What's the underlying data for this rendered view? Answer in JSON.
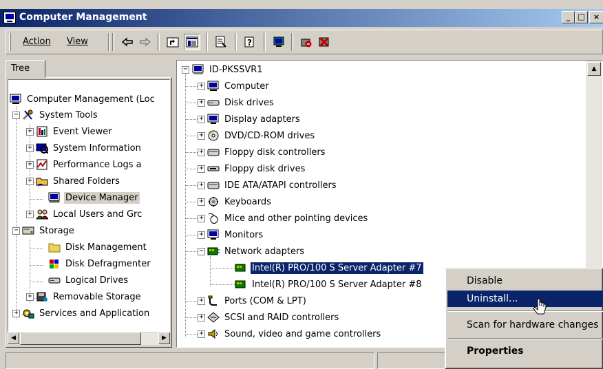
{
  "window": {
    "title": "Computer Management"
  },
  "menu": {
    "action": "Action",
    "action_key": "A",
    "view": "View",
    "view_key": "V"
  },
  "tree_tab": "Tree",
  "left_tree": [
    {
      "label": "Computer Management (Loc",
      "icon": "computer-management-icon"
    },
    {
      "label": "System Tools",
      "icon": "tools-icon"
    },
    {
      "label": "Event Viewer",
      "icon": "event-viewer-icon"
    },
    {
      "label": "System Information",
      "icon": "system-information-icon"
    },
    {
      "label": "Performance Logs a",
      "icon": "performance-logs-icon"
    },
    {
      "label": "Shared Folders",
      "icon": "shared-folders-icon"
    },
    {
      "label": "Device Manager",
      "icon": "device-manager-icon"
    },
    {
      "label": "Local Users and Grc",
      "icon": "users-icon"
    },
    {
      "label": "Storage",
      "icon": "storage-icon"
    },
    {
      "label": "Disk Management",
      "icon": "folder-icon"
    },
    {
      "label": "Disk Defragmenter",
      "icon": "defragmenter-icon"
    },
    {
      "label": "Logical Drives",
      "icon": "drive-icon"
    },
    {
      "label": "Removable Storage",
      "icon": "removable-storage-icon"
    },
    {
      "label": "Services and Application",
      "icon": "services-icon"
    }
  ],
  "right_tree": [
    {
      "label": "ID-PKSSVR1",
      "icon": "computer-icon"
    },
    {
      "label": "Computer",
      "icon": "computer-icon"
    },
    {
      "label": "Disk drives",
      "icon": "disk-icon"
    },
    {
      "label": "Display adapters",
      "icon": "monitor-icon"
    },
    {
      "label": "DVD/CD-ROM drives",
      "icon": "cdrom-icon"
    },
    {
      "label": "Floppy disk controllers",
      "icon": "controller-icon"
    },
    {
      "label": "Floppy disk drives",
      "icon": "floppy-icon"
    },
    {
      "label": "IDE ATA/ATAPI controllers",
      "icon": "controller-icon"
    },
    {
      "label": "Keyboards",
      "icon": "keyboard-icon"
    },
    {
      "label": "Mice and other pointing devices",
      "icon": "mouse-icon"
    },
    {
      "label": "Monitors",
      "icon": "monitor-icon"
    },
    {
      "label": "Network adapters",
      "icon": "network-icon"
    },
    {
      "label": "Intel(R) PRO/100 S Server Adapter #7",
      "icon": "network-card-icon"
    },
    {
      "label": "Intel(R) PRO/100 S Server Adapter #8",
      "icon": "network-card-icon"
    },
    {
      "label": "Ports (COM & LPT)",
      "icon": "port-icon"
    },
    {
      "label": "SCSI and RAID controllers",
      "icon": "scsi-icon"
    },
    {
      "label": "Sound, video and game controllers",
      "icon": "sound-icon"
    }
  ],
  "context_menu": {
    "disable": "Disable",
    "uninstall": "Uninstall...",
    "scan": "Scan for hardware changes",
    "properties": "Properties"
  },
  "colors": {
    "selection": "#0a246a",
    "face": "#d4d0c8"
  }
}
